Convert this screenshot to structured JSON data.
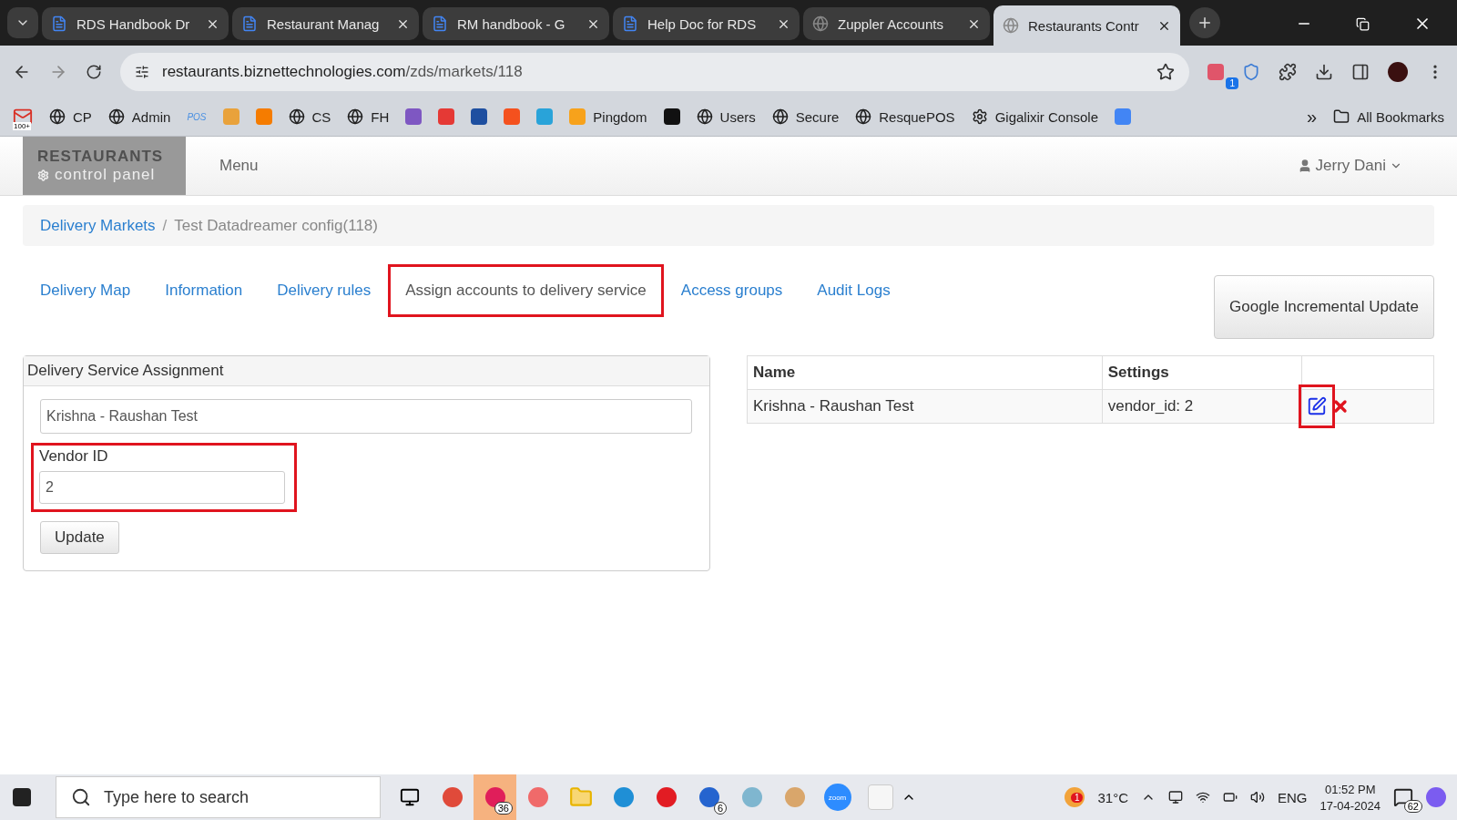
{
  "browser": {
    "tabs": [
      {
        "title": "RDS Handbook Dr",
        "kind": "doc",
        "selected": false
      },
      {
        "title": "Restaurant Manag",
        "kind": "doc",
        "selected": false
      },
      {
        "title": "RM handbook - G",
        "kind": "doc",
        "selected": false
      },
      {
        "title": "Help Doc for RDS",
        "kind": "doc",
        "selected": false
      },
      {
        "title": "Zuppler Accounts",
        "kind": "globe",
        "selected": false
      },
      {
        "title": "Restaurants Contr",
        "kind": "globe",
        "selected": true
      }
    ],
    "url_host": "restaurants.biznettechnologies.com",
    "url_path": "/zds/markets/118",
    "extension_badge": "1",
    "bookmarks": [
      {
        "kind": "mail",
        "badge": "100+"
      },
      {
        "kind": "globe",
        "label": "CP"
      },
      {
        "kind": "globe",
        "label": "Admin"
      },
      {
        "kind": "text",
        "label": "POS"
      },
      {
        "kind": "app",
        "color": "#e9a23b"
      },
      {
        "kind": "app",
        "color": "#f57c00"
      },
      {
        "kind": "globe",
        "label": "CS"
      },
      {
        "kind": "globe",
        "label": "FH"
      },
      {
        "kind": "app",
        "color": "#7e57c2"
      },
      {
        "kind": "app",
        "color": "#e53935"
      },
      {
        "kind": "app",
        "color": "#1e4fa0"
      },
      {
        "kind": "app",
        "color": "#f4511e"
      },
      {
        "kind": "app",
        "color": "#29a3d9"
      },
      {
        "kind": "app",
        "label": "Pingdom",
        "color": "#f7a21b"
      },
      {
        "kind": "app",
        "color": "#111111"
      },
      {
        "kind": "globe",
        "label": "Users"
      },
      {
        "kind": "globe",
        "label": "Secure"
      },
      {
        "kind": "globe",
        "label": "ResquePOS"
      },
      {
        "kind": "glyph",
        "label": "Gigalixir Console"
      },
      {
        "kind": "app",
        "color": "#4285f4"
      }
    ],
    "more": "»",
    "all_bookmarks": "All Bookmarks"
  },
  "app": {
    "brand_title": "RESTAURANTS",
    "brand_subtitle": "control panel",
    "menu": "Menu",
    "user": "Jerry Dani"
  },
  "breadcrumb_separator": "/",
  "breadcrumb": [
    {
      "label": "Delivery Markets",
      "link": true
    },
    {
      "label": "Test Datadreamer config(118)",
      "link": false
    }
  ],
  "tabs": [
    {
      "label": "Delivery Map",
      "selected": false,
      "highlighted": false
    },
    {
      "label": "Information",
      "selected": false,
      "highlighted": false
    },
    {
      "label": "Delivery rules",
      "selected": false,
      "highlighted": false
    },
    {
      "label": "Assign accounts to delivery service",
      "selected": true,
      "highlighted": true
    },
    {
      "label": "Access groups",
      "selected": false,
      "highlighted": false
    },
    {
      "label": "Audit Logs",
      "selected": false,
      "highlighted": false
    }
  ],
  "action_button": "Google Incremental Update",
  "form": {
    "title": "Delivery Service Assignment",
    "account": "Krishna - Raushan Test",
    "vendor_label": "Vendor ID",
    "vendor_value": "2",
    "vendor_highlighted": true,
    "submit": "Update"
  },
  "table": {
    "columns": [
      "Name",
      "Settings"
    ],
    "rows": [
      {
        "name": "Krishna - Raushan Test",
        "settings": "vendor_id: 2",
        "edit_highlighted": true
      }
    ]
  },
  "taskbar": {
    "search_placeholder": "Type here to search",
    "apps": [
      {
        "kind": "taskview"
      },
      {
        "kind": "chrome"
      },
      {
        "kind": "slack",
        "badge": "36",
        "selected": true
      },
      {
        "kind": "asana"
      },
      {
        "kind": "folder"
      },
      {
        "kind": "edge"
      },
      {
        "kind": "opera"
      },
      {
        "kind": "todo",
        "badge": "6"
      },
      {
        "kind": "notes"
      },
      {
        "kind": "paint"
      },
      {
        "kind": "zoom",
        "label": "zoom"
      },
      {
        "kind": "blank"
      }
    ],
    "weather_badge": "1",
    "temperature": "31°C",
    "language": "ENG",
    "time": "01:52 PM",
    "date": "17-04-2024",
    "notifications": "62"
  }
}
